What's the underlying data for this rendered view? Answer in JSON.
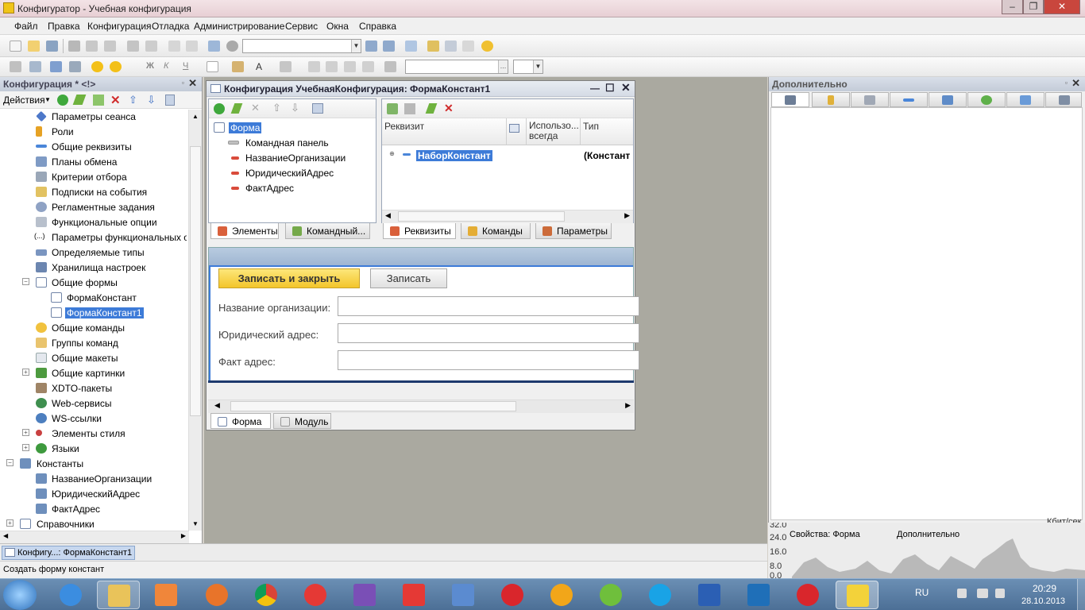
{
  "window": {
    "title": "Конфигуратор - Учебная конфигурация"
  },
  "menu": [
    "Файл",
    "Правка",
    "Конфигурация",
    "Отладка",
    "Администрирование",
    "Сервис",
    "Окна",
    "Справка"
  ],
  "left_panel": {
    "title": "Конфигурация * <!>",
    "actions_label": "Действия",
    "tree": [
      "Параметры сеанса",
      "Роли",
      "Общие реквизиты",
      "Планы обмена",
      "Критерии отбора",
      "Подписки на события",
      "Регламентные задания",
      "Функциональные опции",
      "Параметры функциональных опц",
      "Определяемые типы",
      "Хранилища настроек",
      "Общие формы",
      "ФормаКонстант",
      "ФормаКонстант1",
      "Общие команды",
      "Группы команд",
      "Общие макеты",
      "Общие картинки",
      "XDTO-пакеты",
      "Web-сервисы",
      "WS-ссылки",
      "Элементы стиля",
      "Языки",
      "Константы",
      "НазваниеОрганизации",
      "ЮридическийАдрес",
      "ФактАдрес",
      "Справочники"
    ]
  },
  "form_window": {
    "title": "Конфигурация УчебнаяКонфигурация: ФормаКонстант1",
    "elements": [
      "Форма",
      "Командная панель",
      "НазваниеОрганизации",
      "ЮридическийАдрес",
      "ФактАдрес"
    ],
    "left_tabs": [
      "Элементы",
      "Командный..."
    ],
    "grid_headers": {
      "c1": "Реквизит",
      "c2": "Использо... всегда",
      "c3": "Тип"
    },
    "grid_row": {
      "name": "НаборКонстант",
      "type": "(Констант"
    },
    "right_tabs": [
      "Реквизиты",
      "Команды",
      "Параметры"
    ],
    "preview": {
      "btn_primary": "Записать и закрыть",
      "btn_secondary": "Записать",
      "fields": [
        "Название организации:",
        "Юридический адрес:",
        "Факт адрес:"
      ]
    },
    "bottom_tabs": [
      "Форма",
      "Модуль"
    ]
  },
  "right_panel": {
    "title": "Дополнительно",
    "bottom_tabs": [
      "Свойства: Форма",
      "Дополнительно"
    ],
    "net": {
      "unit": "Кбит/сек",
      "ticks": [
        "32.0",
        "24.0",
        "16.0",
        "8.0",
        "0.0"
      ]
    }
  },
  "mdi_strip": {
    "item": "Конфигу...: ФормаКонстант1"
  },
  "status": {
    "text": "Создать форму констант"
  },
  "taskbar": {
    "lang": "RU",
    "time": "20:29",
    "date": "28.10.2013"
  }
}
